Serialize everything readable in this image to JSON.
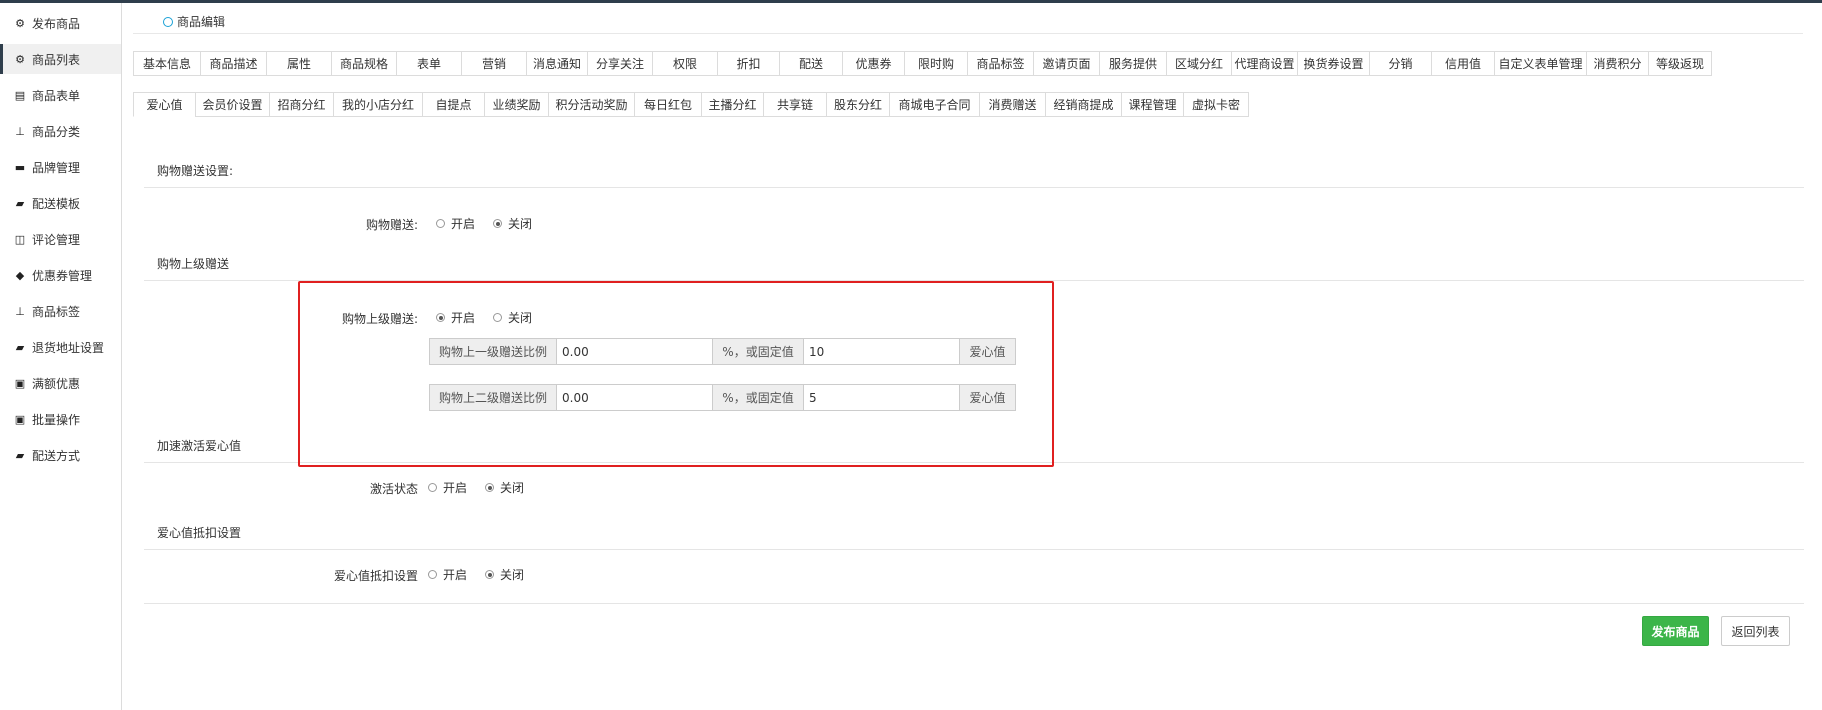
{
  "sidebar": {
    "items": [
      {
        "label": "发布商品",
        "icon": "cubes-icon",
        "glyph": "⚙"
      },
      {
        "label": "商品列表",
        "icon": "cubes-icon",
        "glyph": "⚙"
      },
      {
        "label": "商品表单",
        "icon": "file-icon",
        "glyph": "▤"
      },
      {
        "label": "商品分类",
        "icon": "sitemap-icon",
        "glyph": "⊥"
      },
      {
        "label": "品牌管理",
        "icon": "briefcase-icon",
        "glyph": "▬"
      },
      {
        "label": "配送模板",
        "icon": "truck-icon",
        "glyph": "▰"
      },
      {
        "label": "评论管理",
        "icon": "columns-icon",
        "glyph": "◫"
      },
      {
        "label": "优惠券管理",
        "icon": "tags-icon",
        "glyph": "◆"
      },
      {
        "label": "商品标签",
        "icon": "sitemap-icon",
        "glyph": "⊥"
      },
      {
        "label": "退货地址设置",
        "icon": "truck-icon",
        "glyph": "▰"
      },
      {
        "label": "满额优惠",
        "icon": "gift-icon",
        "glyph": "▣"
      },
      {
        "label": "批量操作",
        "icon": "gift-icon",
        "glyph": "▣"
      },
      {
        "label": "配送方式",
        "icon": "truck-icon",
        "glyph": "▰"
      }
    ],
    "active_index": 1
  },
  "breadcrumb": {
    "label": "商品编辑"
  },
  "tabs_row1": [
    "基本信息",
    "商品描述",
    "属性",
    "商品规格",
    "表单",
    "营销",
    "消息通知",
    "分享关注",
    "权限",
    "折扣",
    "配送",
    "优惠券",
    "限时购",
    "商品标签",
    "邀请页面",
    "服务提供",
    "区域分红",
    "代理商设置",
    "换货券设置",
    "分销",
    "信用值",
    "自定义表单管理",
    "消费积分",
    "等级返现"
  ],
  "tabs_row2": [
    "爱心值",
    "会员价设置",
    "招商分红",
    "我的小店分红",
    "自提点",
    "业绩奖励",
    "积分活动奖励",
    "每日红包",
    "主播分红",
    "共享链",
    "股东分红",
    "商城电子合同",
    "消费赠送",
    "经销商提成",
    "课程管理",
    "虚拟卡密"
  ],
  "active_tab_row2": 0,
  "radio": {
    "on": "开启",
    "off": "关闭"
  },
  "sections": {
    "shopping_gift": {
      "title": "购物赠送设置:",
      "label": "购物赠送:",
      "selected": "off"
    },
    "superior_gift": {
      "title": "购物上级赠送",
      "label": "购物上级赠送:",
      "selected": "on",
      "rows": [
        {
          "prefix": "购物上一级赠送比例",
          "ratio": "0.00",
          "mid": "%，或固定值",
          "fixed": "10",
          "suffix": "爱心值"
        },
        {
          "prefix": "购物上二级赠送比例",
          "ratio": "0.00",
          "mid": "%，或固定值",
          "fixed": "5",
          "suffix": "爱心值"
        }
      ]
    },
    "activation": {
      "title": "加速激活爱心值",
      "label": "激活状态",
      "selected": "off"
    },
    "deduction": {
      "title": "爱心值抵扣设置",
      "label": "爱心值抵扣设置",
      "selected": "off"
    }
  },
  "buttons": {
    "publish": "发布商品",
    "back": "返回列表"
  },
  "colors": {
    "primary_green": "#3cb549",
    "highlight_red": "#e02020",
    "breadcrumb_blue": "#1aa1d6"
  }
}
